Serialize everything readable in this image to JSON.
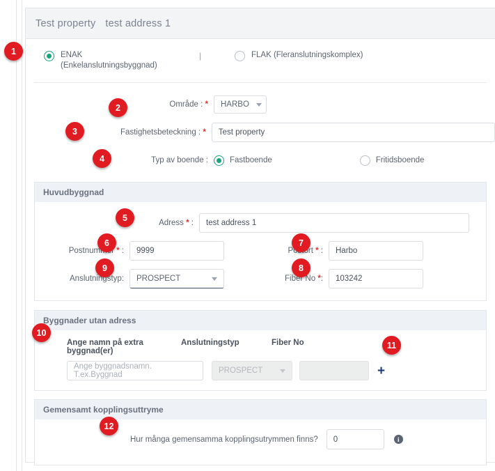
{
  "header": {
    "property_name": "Test property",
    "address": "test address 1"
  },
  "type_selector": {
    "separator": "|",
    "options": [
      {
        "code": "ENAK",
        "full": "(Enkelanslutningsbyggnad)",
        "selected": true
      },
      {
        "code": "FLAK (Fleranslutningskomplex)",
        "full": "",
        "selected": false
      }
    ]
  },
  "general": {
    "omrade_label": "Område :",
    "omrade_value": "HARBO",
    "fastighet_label": "Fastighetsbeteckning :",
    "fastighet_value": "Test property",
    "boende_label": "Typ av boende :",
    "boende_options": [
      {
        "label": "Fastboende",
        "selected": true
      },
      {
        "label": "Fritidsboende",
        "selected": false
      }
    ]
  },
  "huvudbyggnad": {
    "title": "Huvudbyggnad",
    "adress_label": "Adress",
    "adress_value": "test address 1",
    "postnummer_label": "Postnummer",
    "postnummer_value": "9999",
    "postort_label": "Postort",
    "postort_value": "Harbo",
    "anslutningstyp_label": "Anslutningstyp:",
    "anslutningstyp_value": "PROSPECT",
    "fiber_label": "Fiber No",
    "fiber_value": "103242"
  },
  "byggnader_utan_adress": {
    "title": "Byggnader utan adress",
    "col_namn": "Ange namn på extra byggnad(er)",
    "col_anslutningstyp": "Anslutningstyp",
    "col_fiber": "Fiber No",
    "namn_placeholder": "Ange byggnadsnamn. T.ex.Byggnad",
    "anslutningstyp_value": "PROSPECT",
    "fiber_value": "",
    "add_label": "+"
  },
  "gemensamt": {
    "title": "Gemensamt kopplingsuttryme",
    "question": "Hur många gemensamma kopplingsutrymmen finns?",
    "value": "0",
    "info_glyph": "i"
  },
  "badges": [
    {
      "n": "1"
    },
    {
      "n": "2"
    },
    {
      "n": "3"
    },
    {
      "n": "4"
    },
    {
      "n": "5"
    },
    {
      "n": "6"
    },
    {
      "n": "7"
    },
    {
      "n": "8"
    },
    {
      "n": "9"
    },
    {
      "n": "10"
    },
    {
      "n": "11"
    },
    {
      "n": "12"
    }
  ],
  "colors": {
    "badge": "#e01b22",
    "radio_selected": "#1aa47f",
    "required": "#e03131",
    "panel_header": "#eef2f7",
    "add_plus": "#1f3d7a"
  }
}
